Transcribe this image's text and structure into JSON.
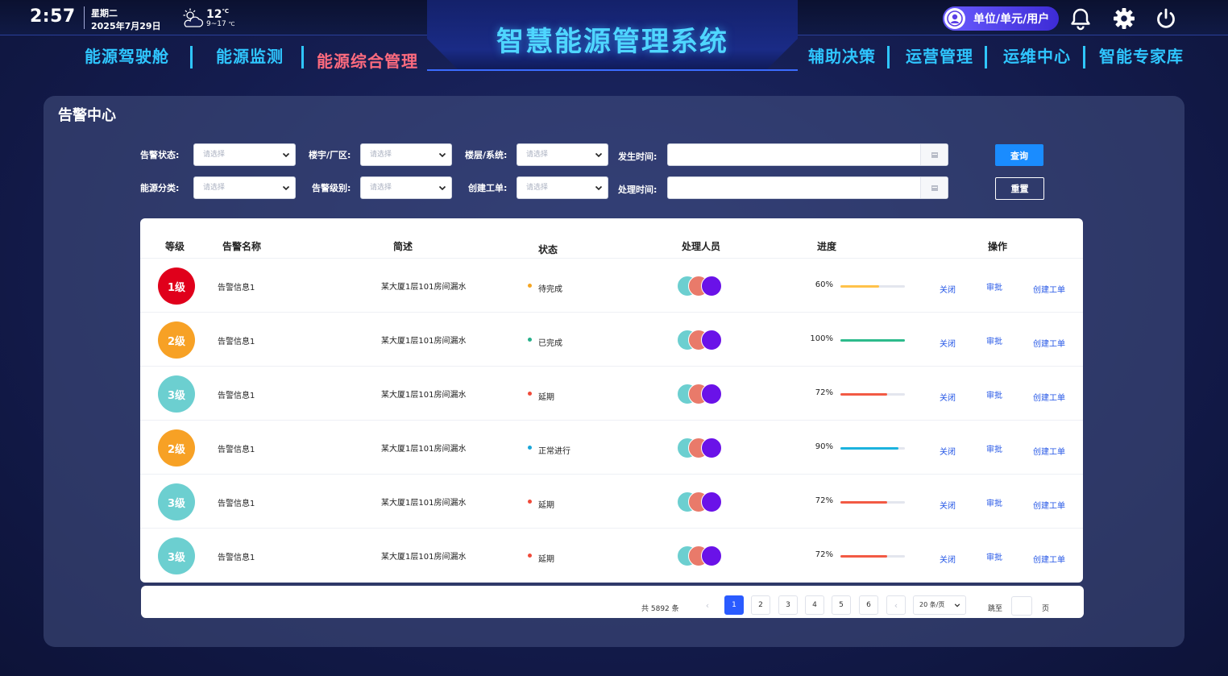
{
  "header": {
    "time": "2:57",
    "weekday": "星期二",
    "date": "2025年7月29日",
    "temperature": "12",
    "temperature_unit": "℃",
    "temperature_range": "9~17",
    "temperature_range_unit": "℃",
    "title": "智慧能源管理系统",
    "user_label": "单位/单元/用户",
    "icons": [
      "partly-cloudy-icon",
      "user-avatar-icon",
      "bell-icon",
      "gear-icon",
      "power-icon"
    ]
  },
  "nav": {
    "left": [
      "能源驾驶舱",
      "能源监测",
      "能源综合管理"
    ],
    "right": [
      "辅助决策",
      "运营管理",
      "运维中心",
      "智能专家库"
    ],
    "active": "能源综合管理"
  },
  "panel": {
    "title": "告警中心"
  },
  "filters": {
    "alarm_status_label": "告警状态:",
    "building_label": "楼宇/厂区:",
    "floor_label": "楼层/系统:",
    "occur_time_label": "发生时间:",
    "energy_type_label": "能源分类:",
    "alarm_level_label": "告警级别:",
    "work_order_label": "创建工单:",
    "handle_time_label": "处理时间:",
    "placeholder": "请选择",
    "query_label": "查询",
    "reset_label": "重置"
  },
  "table": {
    "headers": [
      "等级",
      "告警名称",
      "简述",
      "状态",
      "处理人员",
      "进度",
      "操作"
    ],
    "rows": [
      {
        "level": "1级",
        "level_color": "#e0001b",
        "name": "告警信息1",
        "desc": "某大厦1层101房间漏水",
        "status": "待完成",
        "status_color": "#f5a623",
        "progress_text": "60%",
        "progress": 0.6,
        "bar_color": "#ffc24a"
      },
      {
        "level": "2级",
        "level_color": "#f7a125",
        "name": "告警信息1",
        "desc": "某大厦1层101房间漏水",
        "status": "已完成",
        "status_color": "#27b08a",
        "progress_text": "100%",
        "progress": 1.0,
        "bar_color": "#2dbb8c"
      },
      {
        "level": "3级",
        "level_color": "#6ccfd0",
        "name": "告警信息1",
        "desc": "某大厦1层101房间漏水",
        "status": "延期",
        "status_color": "#f04a3a",
        "progress_text": "72%",
        "progress": 0.72,
        "bar_color": "#f25a44"
      },
      {
        "level": "2级",
        "level_color": "#f7a125",
        "name": "告警信息1",
        "desc": "某大厦1层101房间漏水",
        "status": "正常进行",
        "status_color": "#1aa6d8",
        "progress_text": "90%",
        "progress": 0.9,
        "bar_color": "#1cb3de"
      },
      {
        "level": "3级",
        "level_color": "#6ccfd0",
        "name": "告警信息1",
        "desc": "某大厦1层101房间漏水",
        "status": "延期",
        "status_color": "#f04a3a",
        "progress_text": "72%",
        "progress": 0.72,
        "bar_color": "#f25a44"
      },
      {
        "level": "3级",
        "level_color": "#6ccfd0",
        "name": "告警信息1",
        "desc": "某大厦1层101房间漏水",
        "status": "延期",
        "status_color": "#f04a3a",
        "progress_text": "72%",
        "progress": 0.72,
        "bar_color": "#f25a44"
      }
    ],
    "operations": [
      "关闭",
      "审批",
      "创建工单"
    ],
    "avatar_colors": [
      "#6ccfd0",
      "#e97a6a",
      "#6a12e8"
    ]
  },
  "pagination": {
    "total_text": "共 5892 条",
    "pages": [
      "1",
      "2",
      "3",
      "4",
      "5",
      "6"
    ],
    "current": "1",
    "page_size": "20 条/页",
    "jump_label": "跳至",
    "page_label": "页"
  },
  "colors": {
    "accent": "#2fc6ff",
    "active_nav": "#ff6b7e",
    "primary_button": "#1a8cff",
    "link": "#2456e6"
  }
}
